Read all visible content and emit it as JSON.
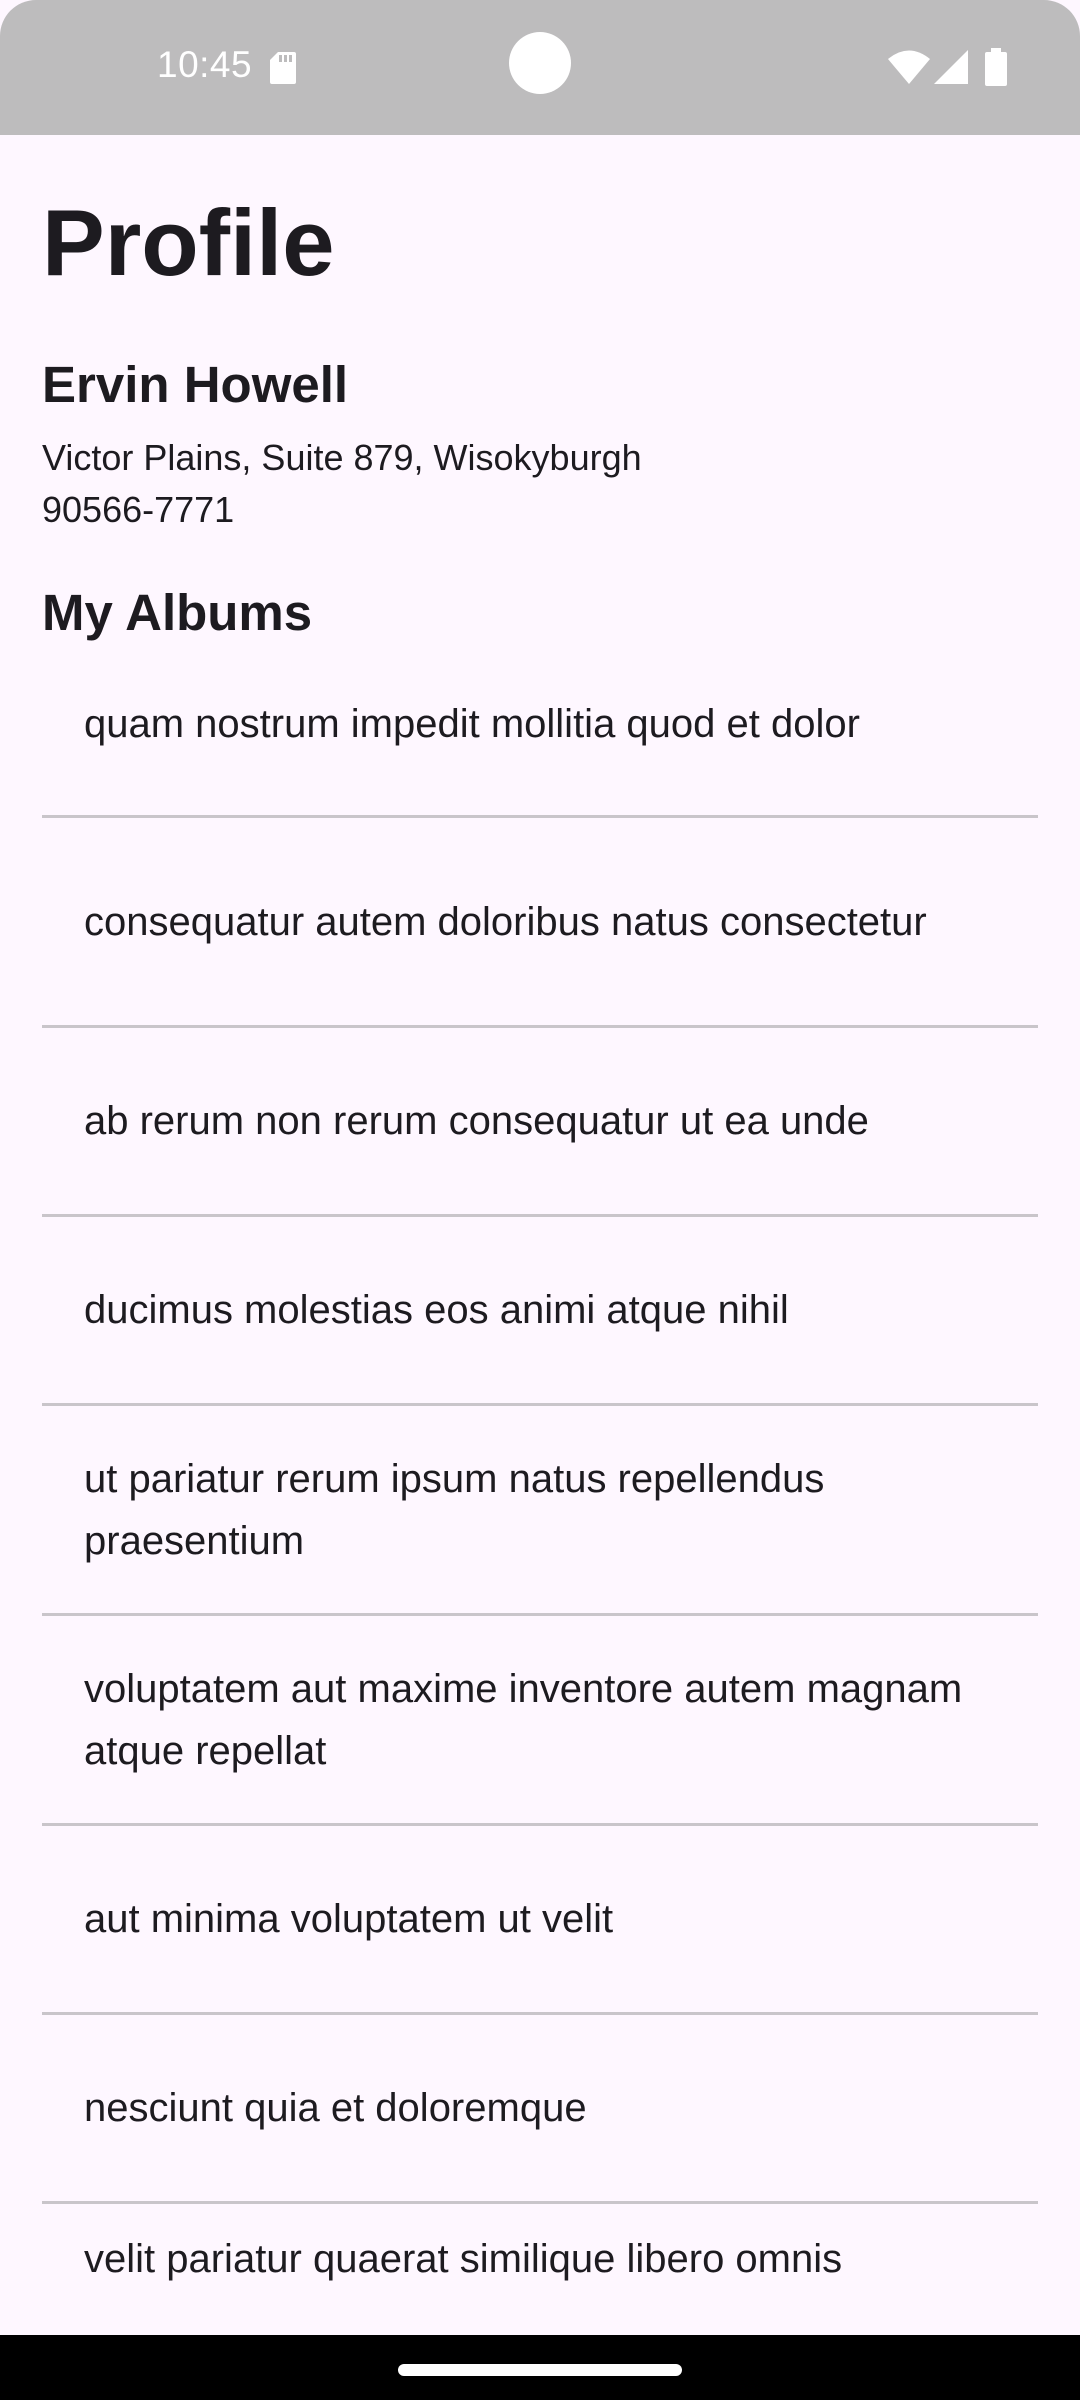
{
  "status_bar": {
    "time": "10:45",
    "icons": [
      "sd-card-icon",
      "wifi-icon",
      "signal-icon",
      "battery-icon"
    ]
  },
  "page": {
    "title": "Profile"
  },
  "profile": {
    "name": "Ervin Howell",
    "address_line1": "Victor Plains, Suite 879, Wisokyburgh",
    "address_line2": "90566-7771"
  },
  "albums": {
    "title": "My Albums",
    "items": [
      "quam nostrum impedit mollitia quod et dolor",
      "consequatur autem doloribus natus consectetur",
      "ab rerum non rerum consequatur ut ea unde",
      "ducimus molestias eos animi atque nihil",
      "ut pariatur rerum ipsum natus repellendus praesentium",
      "voluptatem aut maxime inventore autem magnam atque repellat",
      "aut minima voluptatem ut velit",
      "nesciunt quia et doloremque",
      "velit pariatur quaerat similique libero omnis"
    ]
  },
  "colors": {
    "status_bar": "#bdbcbd",
    "background": "#fef7ff",
    "text": "#1d1b20",
    "divider": "#c9c5ca",
    "nav_bar": "#000000"
  }
}
